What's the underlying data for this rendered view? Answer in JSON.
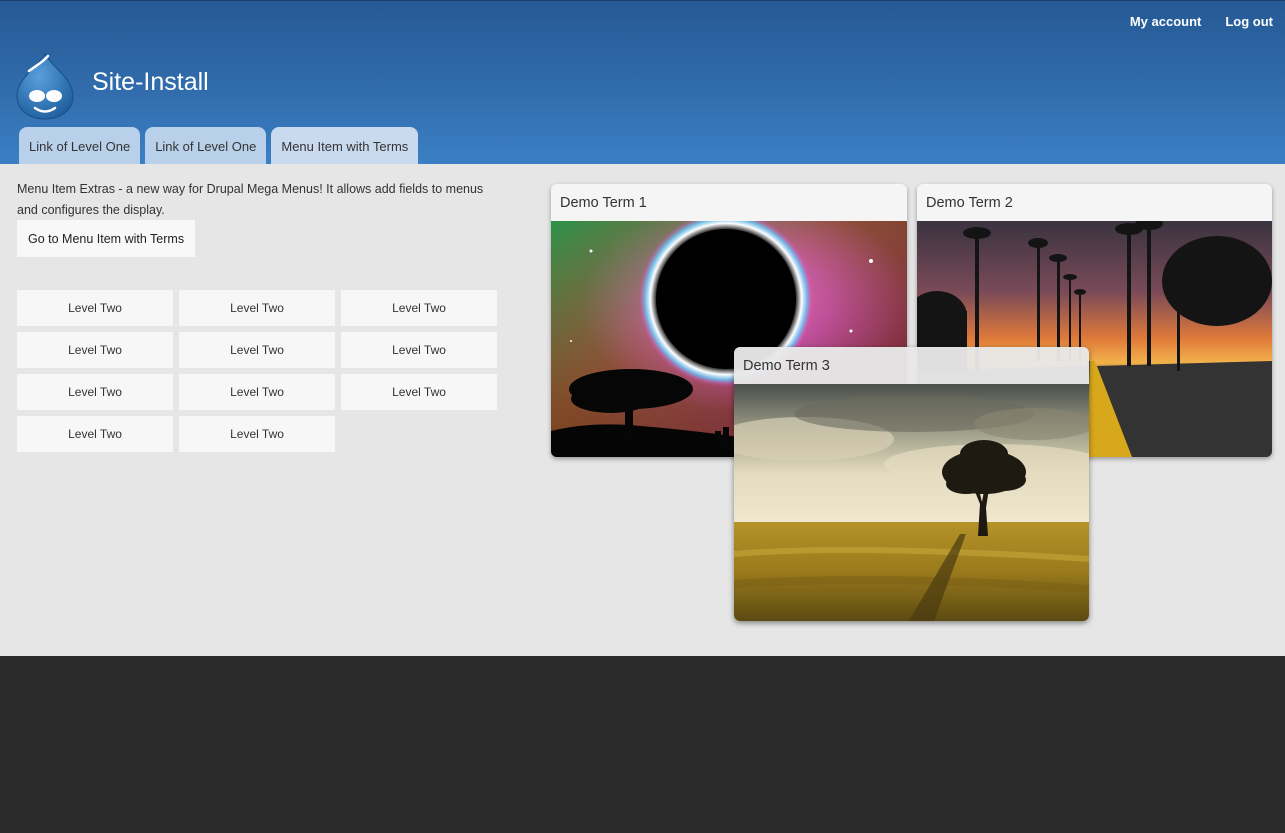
{
  "header": {
    "site_name": "Site-Install",
    "secondary_menu": [
      "My account",
      "Log out"
    ],
    "main_menu": [
      "Link of Level One",
      "Link of Level One",
      "Menu Item with Terms"
    ]
  },
  "mega_menu": {
    "description": "Menu Item Extras - a new way for Drupal Mega Menus! It allows add fields to menus and configures the display.",
    "button_label": "Go to Menu Item with Terms",
    "level_two_items": [
      "Level Two",
      "Level Two",
      "Level Two",
      "Level Two",
      "Level Two",
      "Level Two",
      "Level Two",
      "Level Two",
      "Level Two",
      "Level Two",
      "Level Two"
    ],
    "terms": [
      {
        "title": "Demo Term 1"
      },
      {
        "title": "Demo Term 2"
      },
      {
        "title": "Demo Term 3"
      }
    ]
  },
  "colors": {
    "header_top": "#255994",
    "header_bottom": "#3b7fc4",
    "tab_background": "#b9d0ea",
    "panel_background": "#e6e6e6",
    "footer_background": "#2a2a2a"
  }
}
